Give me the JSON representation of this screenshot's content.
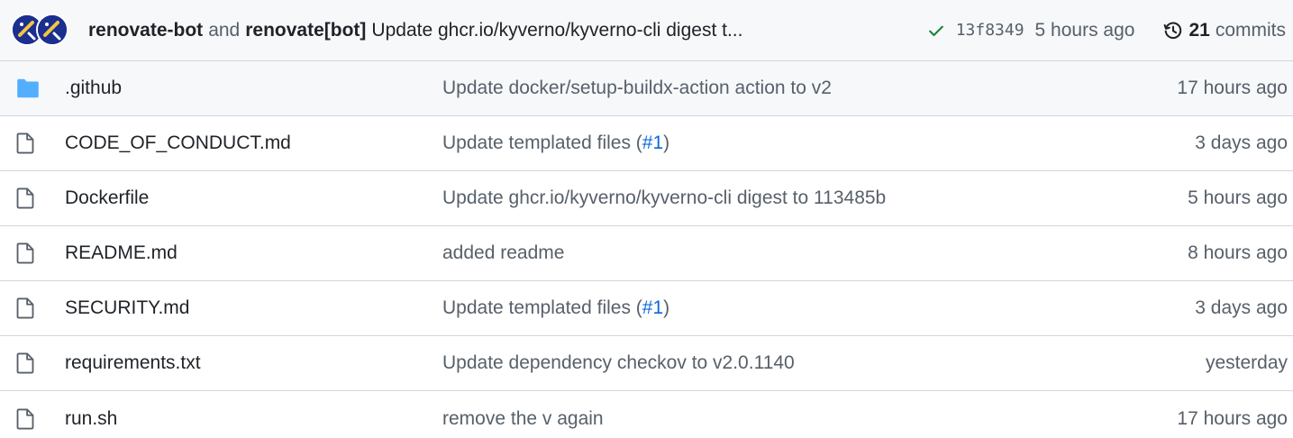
{
  "header": {
    "author1": "renovate-bot",
    "joiner": "and",
    "author2": "renovate[bot]",
    "message": "Update ghcr.io/kyverno/kyverno-cli digest t...",
    "sha": "13f8349",
    "time": "5 hours ago",
    "commit_count": "21",
    "commits_label": "commits"
  },
  "files": [
    {
      "icon": "folder-icon",
      "name": ".github",
      "msg_pre": "Update docker/setup-buildx-action action to v2",
      "link": "",
      "msg_post": "",
      "age": "17 hours ago"
    },
    {
      "icon": "file-icon",
      "name": "CODE_OF_CONDUCT.md",
      "msg_pre": "Update templated files (",
      "link": "#1",
      "msg_post": ")",
      "age": "3 days ago"
    },
    {
      "icon": "file-icon",
      "name": "Dockerfile",
      "msg_pre": "Update ghcr.io/kyverno/kyverno-cli digest to 113485b",
      "link": "",
      "msg_post": "",
      "age": "5 hours ago"
    },
    {
      "icon": "file-icon",
      "name": "README.md",
      "msg_pre": "added readme",
      "link": "",
      "msg_post": "",
      "age": "8 hours ago"
    },
    {
      "icon": "file-icon",
      "name": "SECURITY.md",
      "msg_pre": "Update templated files (",
      "link": "#1",
      "msg_post": ")",
      "age": "3 days ago"
    },
    {
      "icon": "file-icon",
      "name": "requirements.txt",
      "msg_pre": "Update dependency checkov to v2.0.1140",
      "link": "",
      "msg_post": "",
      "age": "yesterday"
    },
    {
      "icon": "file-icon",
      "name": "run.sh",
      "msg_pre": "remove the v again",
      "link": "",
      "msg_post": "",
      "age": "17 hours ago"
    }
  ],
  "colors": {
    "folder": "#54aeff",
    "link": "#0969da",
    "check": "#1a7f37",
    "avatar_bg": "#1a2f8f"
  }
}
